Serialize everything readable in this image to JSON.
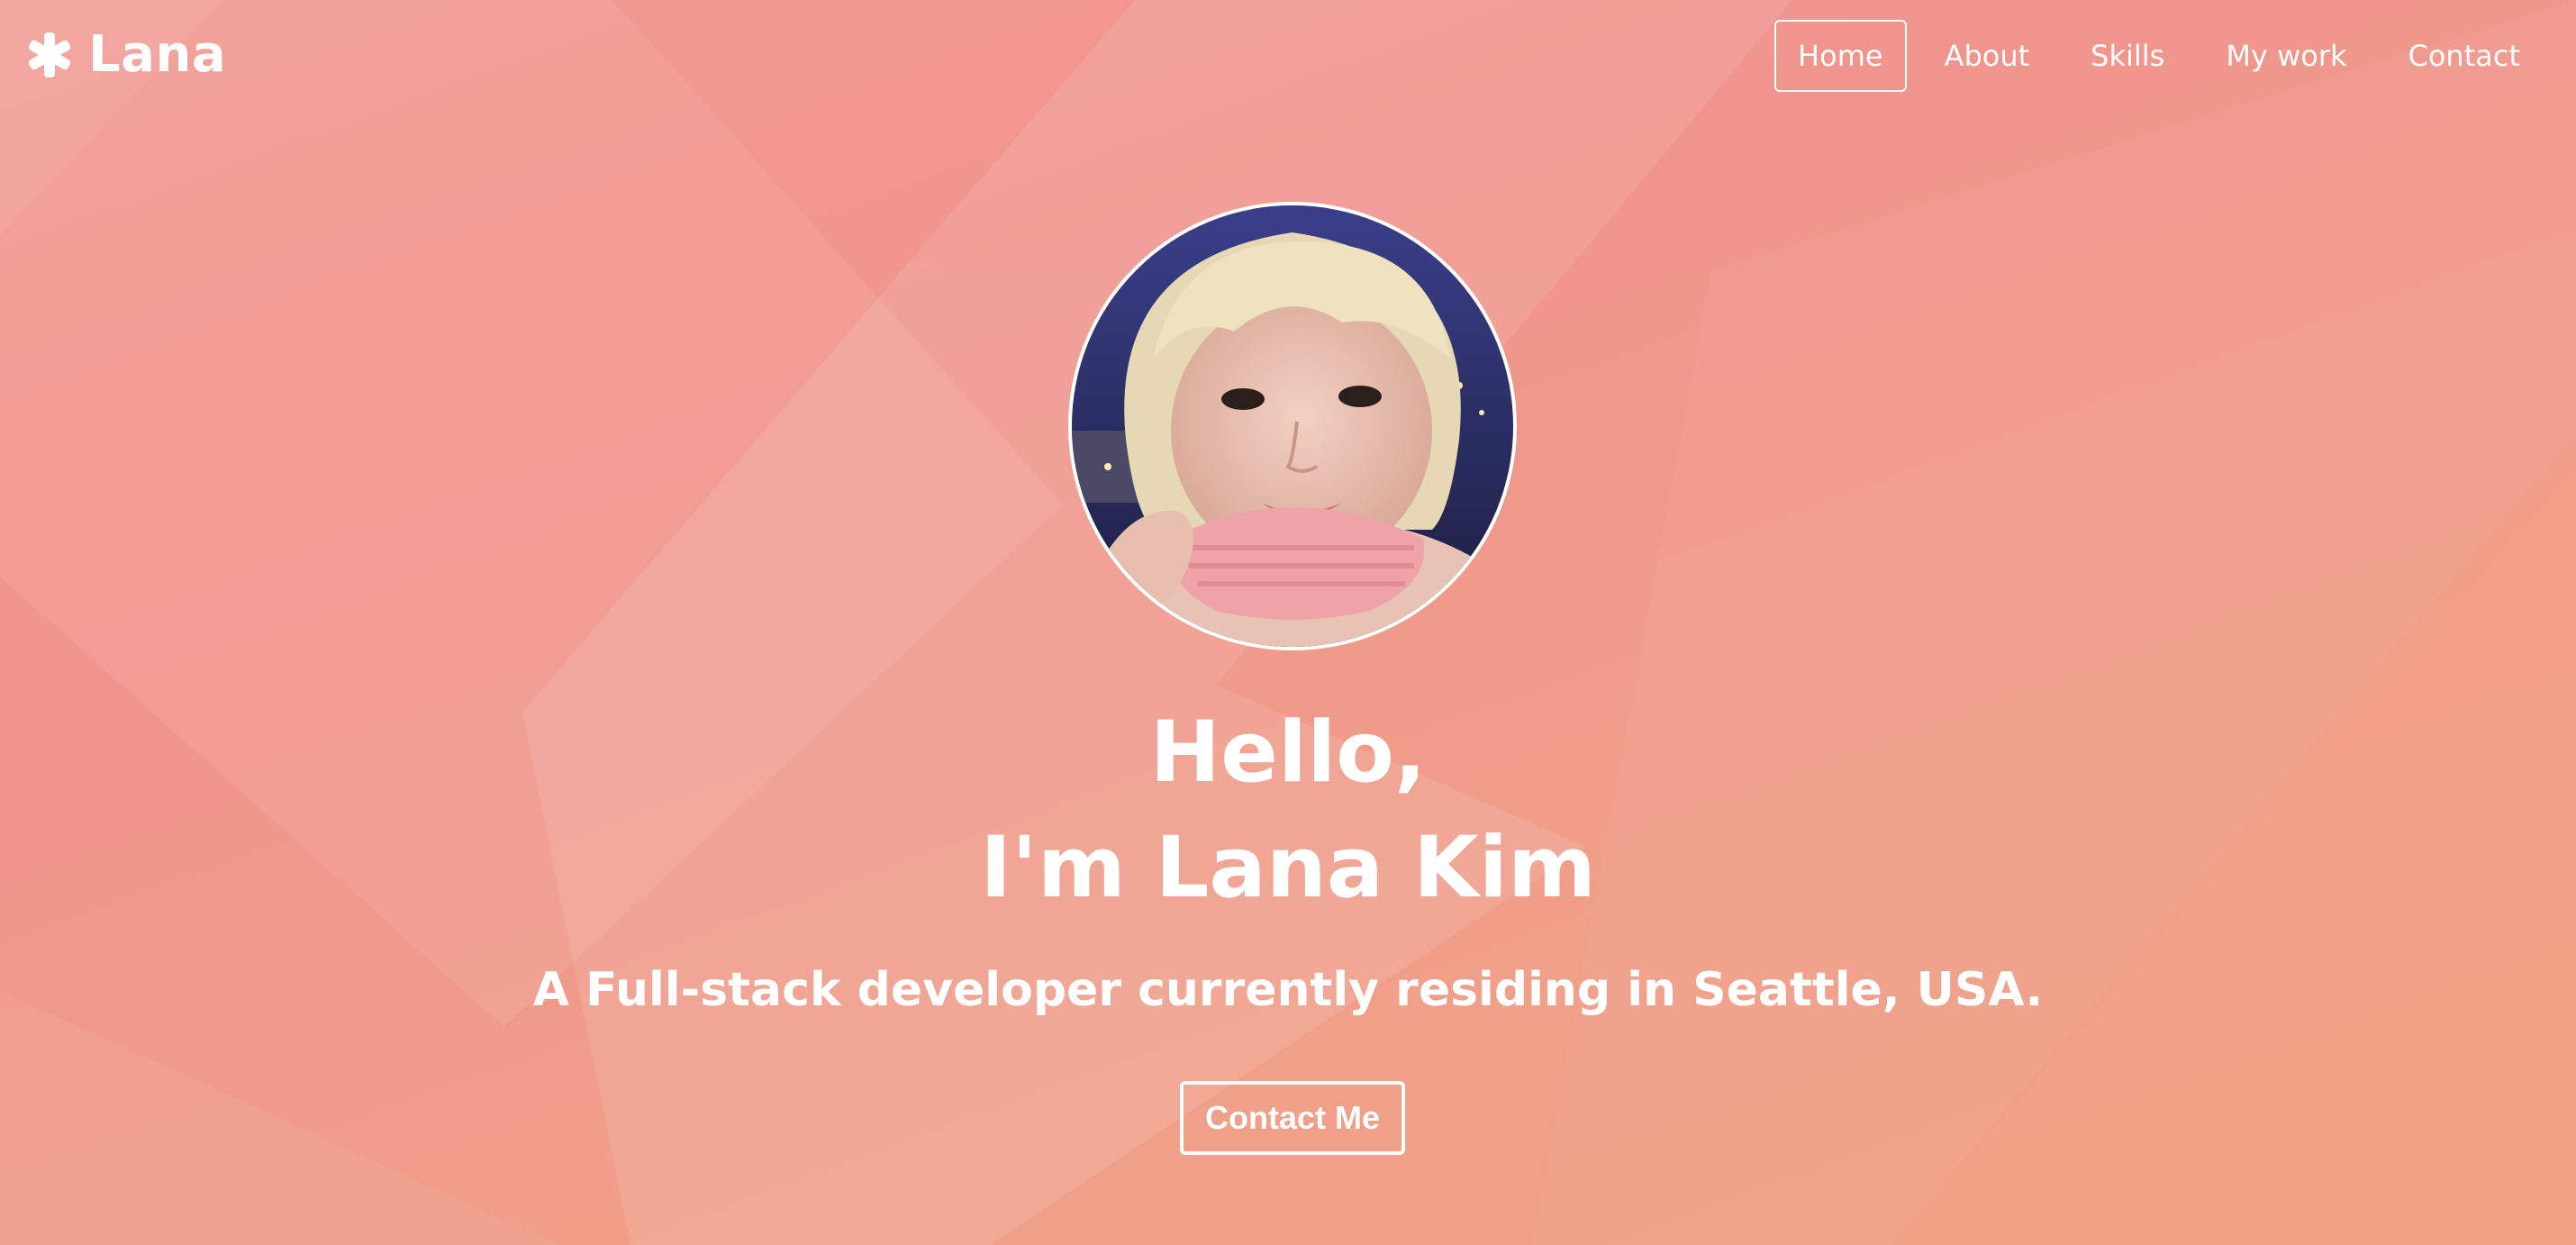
{
  "brand": {
    "name": "Lana",
    "icon": "asterisk-icon"
  },
  "nav": {
    "items": [
      {
        "label": "Home",
        "active": true
      },
      {
        "label": "About",
        "active": false
      },
      {
        "label": "Skills",
        "active": false
      },
      {
        "label": "My work",
        "active": false
      },
      {
        "label": "Contact",
        "active": false
      }
    ]
  },
  "hero": {
    "title_line1": "Hello,",
    "title_line2": "I'm Lana Kim",
    "subtitle": "A Full-stack developer currently residing in Seattle, USA.",
    "cta_label": "Contact Me",
    "avatar": "profile-photo"
  },
  "colors": {
    "background_top": "#f29a94",
    "background_bottom": "#f0a286",
    "text": "#ffffff"
  }
}
